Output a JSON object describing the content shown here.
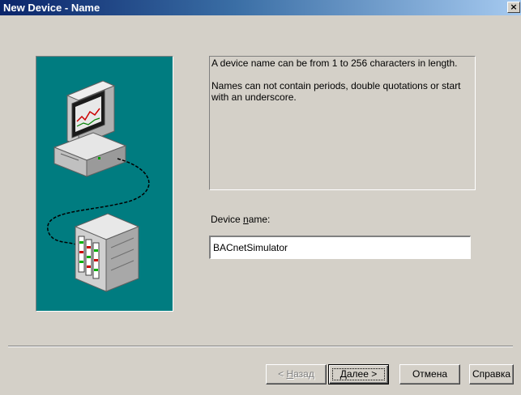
{
  "window": {
    "title": "New Device - Name",
    "close_label": "×"
  },
  "info": {
    "line1": "A device name can be from 1 to 256 characters in length.",
    "line2": "Names can not contain periods, double quotations or start with an underscore."
  },
  "field": {
    "label_prefix": "Device ",
    "label_mnemonic": "n",
    "label_suffix": "ame:",
    "value": "BACnetSimulator"
  },
  "buttons": {
    "back_prefix": "< ",
    "back_mnemonic": "Н",
    "back_suffix": "азад",
    "next_mnemonic": "Д",
    "next_suffix": "алее >",
    "cancel": "Отмена",
    "help": "Справка"
  },
  "colors": {
    "illustration_bg": "#007c80",
    "dialog_bg": "#d4d0c8"
  },
  "icons": {
    "close": "close-icon",
    "computer": "computer-icon",
    "controller": "device-cabinet-icon"
  }
}
